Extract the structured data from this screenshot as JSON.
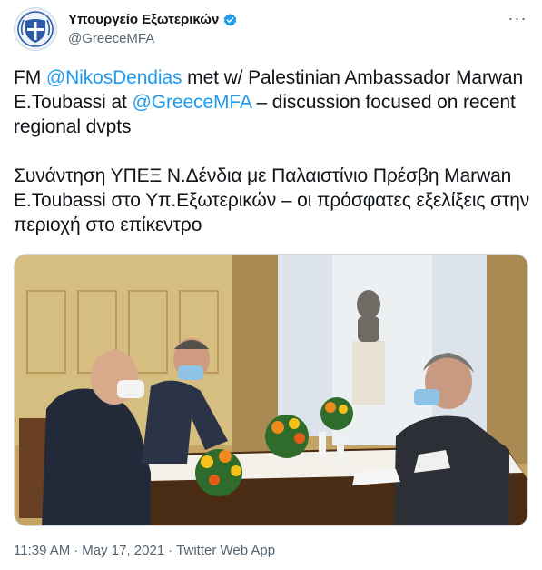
{
  "author": {
    "display_name": "Υπουργείο Εξωτερικών",
    "handle": "@GreeceMFA",
    "avatar_icon": "greek-coat-of-arms-icon",
    "verified_icon": "verified-badge-icon",
    "verified_color": "#1d9bf0"
  },
  "more_icon": "more-options-icon",
  "more_label": "···",
  "tweet": {
    "p1_prefix": "FM ",
    "mention1": "@NikosDendias",
    "p1_middle": " met w/ Palestinian Ambassador Marwan E.Toubassi at ",
    "mention2": "@GreeceMFA",
    "p1_suffix": " – discussion focused on recent regional dvpts",
    "p2": "Συνάντηση ΥΠΕΞ Ν.Δένδια με Παλαιστίνιο Πρέσβη Marwan E.Toubassi στο Υπ.Εξωτερικών – οι πρόσφατες εξελίξεις στην περιοχή στο επίκεντρο"
  },
  "colors": {
    "link": "#1d9bf0",
    "text": "#0f1419",
    "secondary": "#536471"
  },
  "meta": {
    "time": "11:39 AM",
    "sep": "·",
    "date": "May 17, 2021",
    "sep2": "·",
    "app": "Twitter Web App"
  }
}
